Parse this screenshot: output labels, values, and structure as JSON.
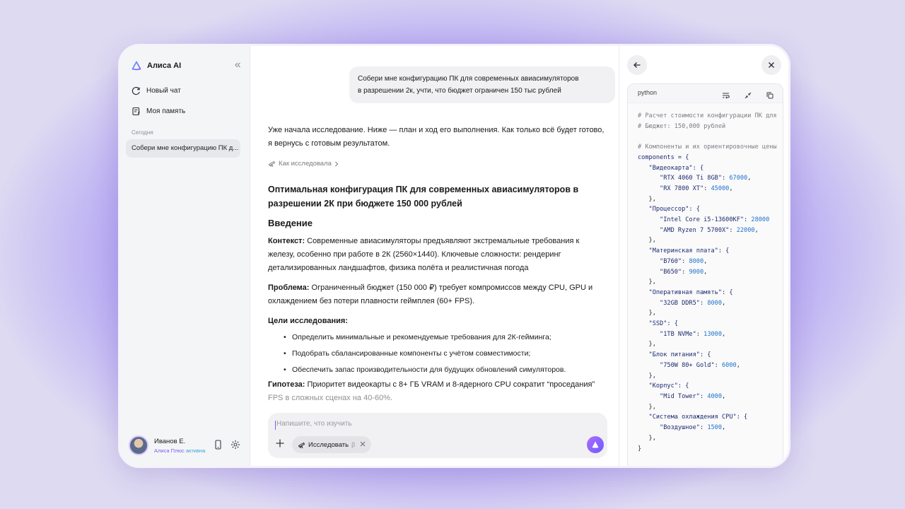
{
  "app": {
    "name": "Алиса AI",
    "collapse_icon": "chevrons-left-icon"
  },
  "sidebar": {
    "new_chat": "Новый чат",
    "memory": "Моя память",
    "section_today": "Сегодня",
    "history": [
      "Собери мне конфигурацию ПК д..."
    ],
    "profile": {
      "name": "Иванов Е.",
      "sub_prefix": "Алиса Плюс",
      "sub_suffix": "активна"
    }
  },
  "chat": {
    "user_message_line1": "Собери мне конфигурацию ПК для современных авиасимуляторов",
    "user_message_line2": "в разрешении 2к, учти, что бюджет ограничен 150 тыс рублей",
    "assistant_intro_line1": "Уже начала исследование. Ниже — план и ход его выполнения. Как только всё будет готово,",
    "assistant_intro_line2": "я вернусь с готовым результатом.",
    "how_researched": "Как исследовала",
    "answer": {
      "title_line1": "Оптимальная конфигурация ПК для современных авиасимуляторов в",
      "title_line2": "разрешении 2К при бюджете 150 000 рублей",
      "intro_heading": "Введение",
      "context_label": "Контекст:",
      "context_line1": " Современные авиасимуляторы предъявляют экстремальные требования к",
      "context_line2": "железу, особенно при работе в 2К (2560×1440). Ключевые сложности: рендеринг",
      "context_line3": "детализированных ландшафтов, физика полёта и реалистичная погода",
      "problem_label": "Проблема:",
      "problem_line1": " Ограниченный бюджет (150 000 ₽) требует компромиссов между CPU, GPU и",
      "problem_line2": "охлаждением без потери плавности геймплея (60+ FPS).",
      "goals_heading": "Цели исследования:",
      "goals": [
        "Определить минимальные и рекомендуемые требования для 2К-гейминга;",
        "Подобрать сбалансированные компоненты с учётом совместимости;",
        "Обеспечить запас производительности для будущих обновлений симуляторов."
      ],
      "hypothesis_label": "Гипотеза:",
      "hypothesis_line1": " Приоритет видеокарты с 8+ ГБ VRAM и 8-ядерного CPU сократит “проседания”",
      "hypothesis_line2": "FPS в сложных сценах на 40-60%."
    },
    "composer": {
      "placeholder": "Напишите, что изучить",
      "chip_label": "Исследовать",
      "chip_beta": "β"
    }
  },
  "code_panel": {
    "language": "python",
    "comment_1": "# Расчет стоимости конфигурации ПК для",
    "comment_2": "# Бюджет: 150,000 рублей",
    "comment_3": "# Компоненты и их ориентировочные цены",
    "var_line": "components = {",
    "groups": [
      {
        "key": "\"Видеокарта\": {",
        "items": [
          {
            "k": "\"RTX 4060 Ti 8GB\": ",
            "v": "67000",
            "s": ","
          },
          {
            "k": "\"RX 7800 XT\": ",
            "v": "45000",
            "s": ","
          }
        ]
      },
      {
        "key": "\"Процессор\": {",
        "items": [
          {
            "k": "\"Intel Core i5-13600KF\": ",
            "v": "28000",
            "s": ""
          },
          {
            "k": "\"AMD Ryzen 7 5700X\": ",
            "v": "22000",
            "s": ","
          }
        ]
      },
      {
        "key": "\"Материнская плата\": {",
        "items": [
          {
            "k": "\"B760\": ",
            "v": "8000",
            "s": ","
          },
          {
            "k": "\"B650\": ",
            "v": "9000",
            "s": ","
          }
        ]
      },
      {
        "key": "\"Оперативная память\": {",
        "items": [
          {
            "k": "\"32GB DDR5\": ",
            "v": "8000",
            "s": ","
          }
        ]
      },
      {
        "key": "\"SSD\": {",
        "items": [
          {
            "k": "\"1TB NVMe\": ",
            "v": "13000",
            "s": ","
          }
        ]
      },
      {
        "key": "\"Блок питания\": {",
        "items": [
          {
            "k": "\"750W 80+ Gold\": ",
            "v": "6000",
            "s": ","
          }
        ]
      },
      {
        "key": "\"Корпус\": {",
        "items": [
          {
            "k": "\"Mid Tower\": ",
            "v": "4000",
            "s": ","
          }
        ]
      },
      {
        "key": "\"Система охлаждения CPU\": {",
        "items": [
          {
            "k": "\"Воздушное\": ",
            "v": "1500",
            "s": ","
          }
        ]
      }
    ],
    "group_close": "},",
    "final_close": "}"
  },
  "colors": {
    "accent": "#7b5cf0",
    "code_number": "#1d73c9",
    "code_string": "#1d2b6e"
  }
}
